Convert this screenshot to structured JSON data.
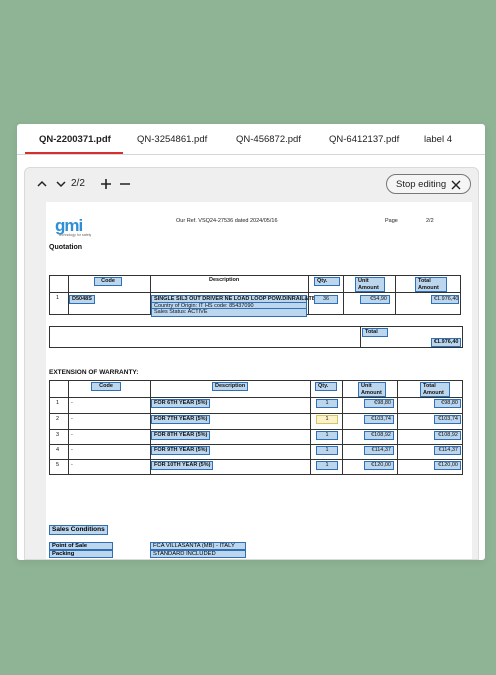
{
  "tabs": [
    {
      "label": "QN-2200371.pdf",
      "active": true
    },
    {
      "label": "QN-3254861.pdf"
    },
    {
      "label": "QN-456872.pdf"
    },
    {
      "label": "QN-6412137.pdf"
    },
    {
      "label": "label 4"
    }
  ],
  "toolbar": {
    "page_indicator": "2/2",
    "stop_editing_label": "Stop editing",
    "icons": [
      "chevron-up-icon",
      "chevron-down-icon",
      "plus-icon",
      "minus-icon",
      "close-icon"
    ]
  },
  "doc": {
    "logo": {
      "text": "gmi",
      "tagline": "technology for safety"
    },
    "ref": "Our Ref. VSQ24-27536 dated 2024/05/16",
    "page_label": "Page",
    "page_num": "2/2",
    "title": "Quotation",
    "main_table": {
      "headers": [
        "Code",
        "Description",
        "Qty.",
        "Unit Amount",
        "Total Amount"
      ],
      "row": {
        "num": "1",
        "code": "D5048S",
        "description": "SINGLE SIL3 OUT DRIVER NE LOAD LOOP POW.DINRAIL&TB",
        "origin": "Country of Origin: IT HS code: 85437090",
        "status": "Sales Status: ACTIVE",
        "qty": "36",
        "unit": "€54,90",
        "total": "€1.976,40"
      }
    },
    "total_box": {
      "label": "Total",
      "value": "€1.976,40"
    },
    "warranty": {
      "title": "EXTENSION OF WARRANTY:",
      "headers": [
        "Code",
        "Description",
        "Qty.",
        "Unit Amount",
        "Total Amount"
      ],
      "rows": [
        {
          "num": "1",
          "code": "-",
          "description": "FOR 6TH YEAR (5%)",
          "qty": "1",
          "unit": "€98,80",
          "total": "€98,80"
        },
        {
          "num": "2",
          "code": "-",
          "description": "FOR 7TH YEAR (5%)",
          "qty": "1",
          "unit": "€103,74",
          "total": "€103,74"
        },
        {
          "num": "3",
          "code": "-",
          "description": "FOR 8TH YEAR (5%)",
          "qty": "1",
          "unit": "€108,92",
          "total": "€108,92"
        },
        {
          "num": "4",
          "code": "-",
          "description": "FOR 9TH YEAR (5%)",
          "qty": "1",
          "unit": "€114,37",
          "total": "€114,37"
        },
        {
          "num": "5",
          "code": "-",
          "description": "FOR 10TH YEAR (5%)",
          "qty": "1",
          "unit": "€120,00",
          "total": "€120,00"
        }
      ]
    },
    "sales": {
      "title": "Sales Conditions",
      "items": [
        {
          "label": "Point of Sale",
          "value": "FCA VILLASANTA (MB) - ITALY"
        },
        {
          "label": "Packing",
          "value": "STANDARD INCLUDED"
        }
      ]
    }
  },
  "colors": {
    "accent": "#d62f2f",
    "highlight": "#bcd6ee",
    "highlight_border": "#2f6fb5",
    "background": "#8fb395"
  }
}
